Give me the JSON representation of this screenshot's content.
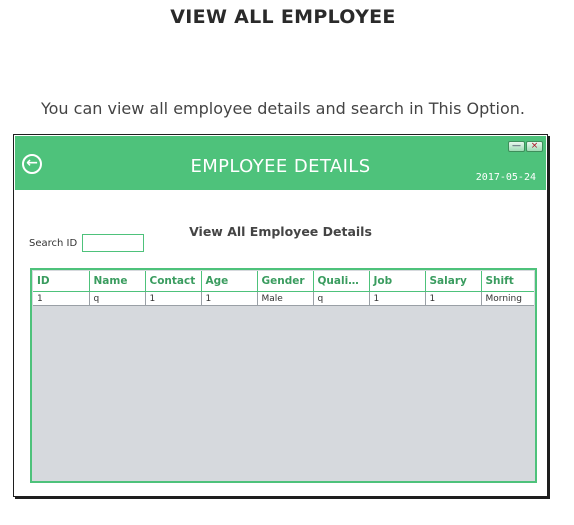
{
  "page": {
    "heading": "VIEW ALL EMPLOYEE",
    "description": "You can view all employee details and search in This Option."
  },
  "app": {
    "title": "EMPLOYEE DETAILS",
    "date": "2017-05-24",
    "back_icon": "back-arrow-circle-icon",
    "window_controls": {
      "minimize": "—",
      "close": "×"
    },
    "section_title": "View All Employee Details",
    "search": {
      "label": "Search ID",
      "value": "",
      "placeholder": ""
    },
    "colors": {
      "accent": "#4ec27b",
      "table_bg": "#d6d9dd",
      "header_text": "#3a9c5f"
    }
  },
  "table": {
    "columns": [
      "ID",
      "Name",
      "Contact",
      "Age",
      "Gender",
      "Qualifi...",
      "Job",
      "Salary",
      "Shift"
    ],
    "rows": [
      [
        "1",
        "q",
        "1",
        "1",
        "Male",
        "q",
        "1",
        "1",
        "Morning"
      ]
    ]
  }
}
